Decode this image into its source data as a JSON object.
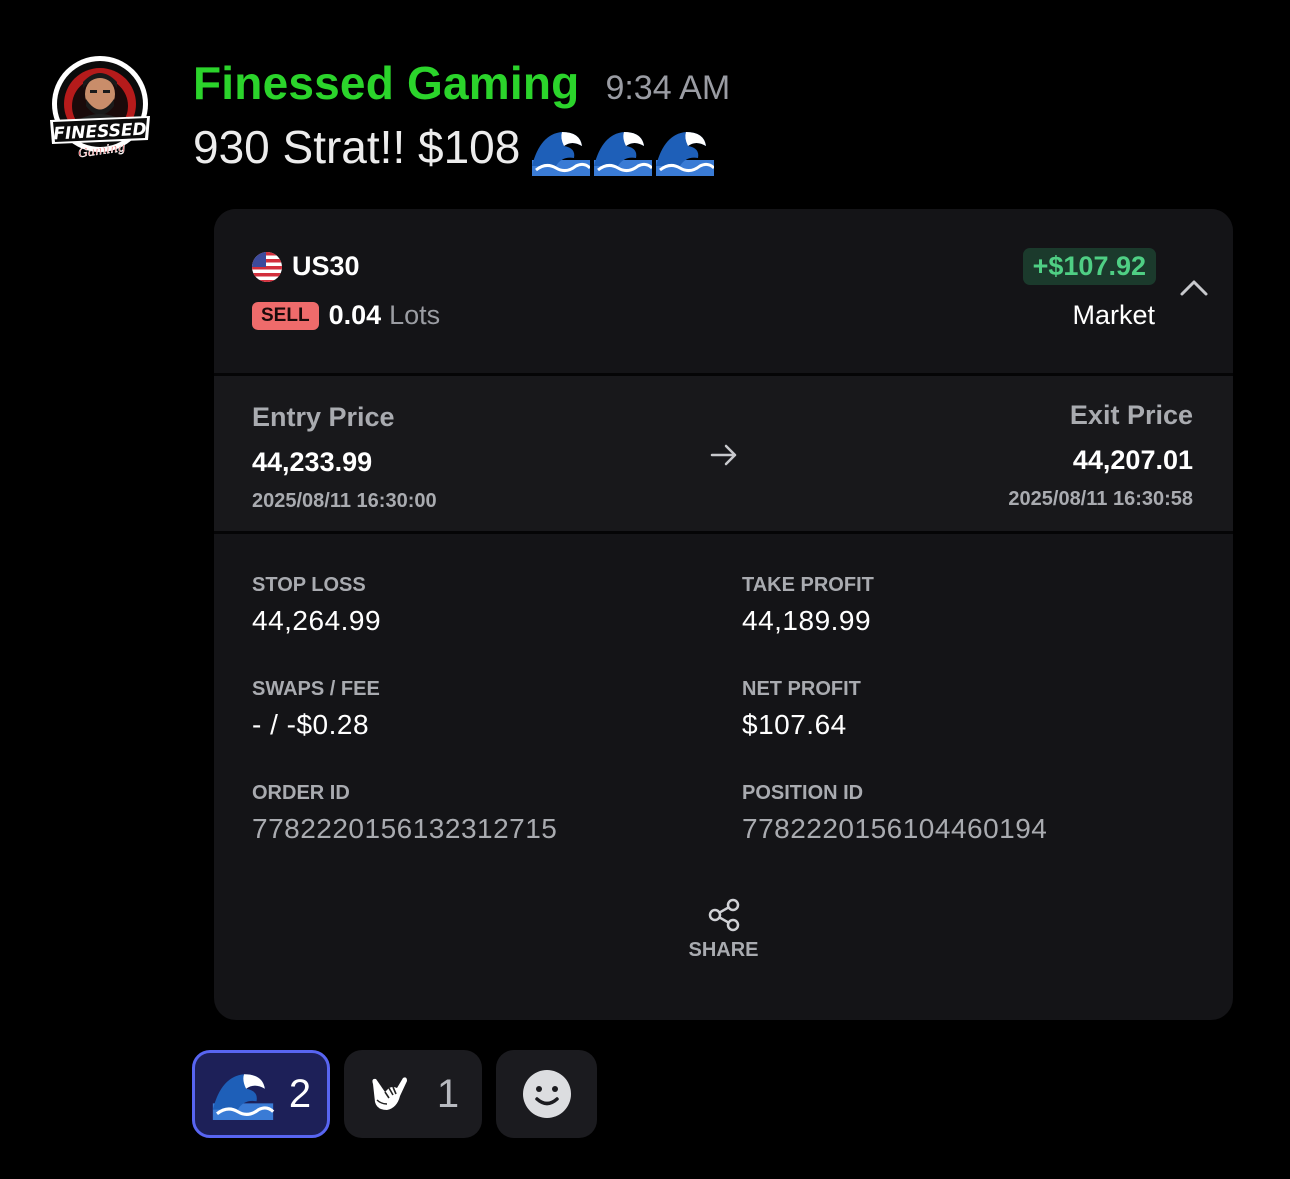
{
  "message": {
    "author": "Finessed Gaming",
    "timestamp": "9:34 AM",
    "text": "930 Strat!! $108",
    "text_emoji": [
      "wave-emoji",
      "wave-emoji",
      "wave-emoji"
    ],
    "author_color": "#2bd42b"
  },
  "avatar": {
    "logo_text": "FINESSED",
    "logo_subtext": "Gaming"
  },
  "trade_card": {
    "symbol": "US30",
    "flag": "us-flag-icon",
    "side": "SELL",
    "lots_value": "0.04",
    "lots_unit": "Lots",
    "profit": "+$107.92",
    "order_type": "Market",
    "entry": {
      "label": "Entry Price",
      "price": "44,233.99",
      "time": "2025/08/11 16:30:00"
    },
    "exit": {
      "label": "Exit Price",
      "price": "44,207.01",
      "time": "2025/08/11 16:30:58"
    },
    "details": {
      "stop_loss_label": "STOP LOSS",
      "stop_loss": "44,264.99",
      "take_profit_label": "TAKE PROFIT",
      "take_profit": "44,189.99",
      "swaps_fee_label": "SWAPS / FEE",
      "swaps_fee": "- / -$0.28",
      "net_profit_label": "NET PROFIT",
      "net_profit": "$107.64",
      "order_id_label": "ORDER ID",
      "order_id": "778222015613231271​5",
      "position_id_label": "POSITION ID",
      "position_id": "778222015610446019​4"
    },
    "share_label": "SHARE",
    "colors": {
      "sell": "#ef6b6b",
      "profit": "#4fcf84"
    }
  },
  "reactions": [
    {
      "emoji": "wave-emoji",
      "count": "2",
      "active": true
    },
    {
      "emoji": "shaka-hand-emoji",
      "count": "1",
      "active": false
    },
    {
      "emoji": "add-reaction-icon"
    }
  ]
}
